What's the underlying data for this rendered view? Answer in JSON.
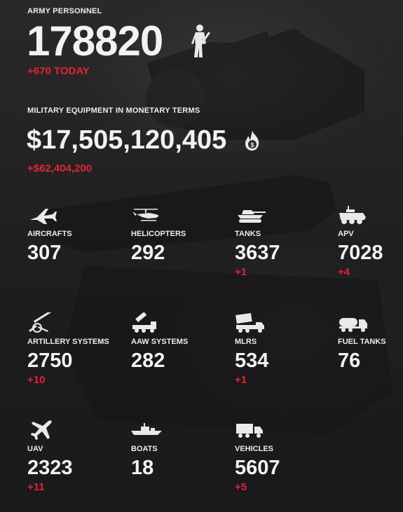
{
  "personnel": {
    "label": "ARMY PERSONNEL",
    "value": "178820",
    "delta": "+670 TODAY",
    "icon": "soldier-icon"
  },
  "money": {
    "label": "MILITARY EQUIPMENT IN MONETARY TERMS",
    "value": "$17,505,120,405",
    "delta": "+$62,404,200",
    "icon": "fire-coin-icon"
  },
  "accent_color": "#e32434",
  "equipment": [
    {
      "label": "AIRCRAFTS",
      "value": "307",
      "delta": "",
      "icon": "fighter-jet-icon"
    },
    {
      "label": "HELICOPTERS",
      "value": "292",
      "delta": "",
      "icon": "helicopter-icon"
    },
    {
      "label": "TANKS",
      "value": "3637",
      "delta": "+1",
      "icon": "tank-icon"
    },
    {
      "label": "APV",
      "value": "7028",
      "delta": "+4",
      "icon": "armored-vehicle-icon"
    },
    {
      "label": "ARTILLERY SYSTEMS",
      "value": "2750",
      "delta": "+10",
      "icon": "artillery-icon"
    },
    {
      "label": "AAW SYSTEMS",
      "value": "282",
      "delta": "",
      "icon": "anti-air-launcher-icon"
    },
    {
      "label": "MLRS",
      "value": "534",
      "delta": "+1",
      "icon": "rocket-launcher-truck-icon"
    },
    {
      "label": "FUEL TANKS",
      "value": "76",
      "delta": "",
      "icon": "fuel-truck-icon"
    },
    {
      "label": "UAV",
      "value": "2323",
      "delta": "+11",
      "icon": "drone-plane-icon"
    },
    {
      "label": "BOATS",
      "value": "18",
      "delta": "",
      "icon": "warship-icon"
    },
    {
      "label": "VEHICLES",
      "value": "5607",
      "delta": "+5",
      "icon": "truck-icon"
    }
  ]
}
